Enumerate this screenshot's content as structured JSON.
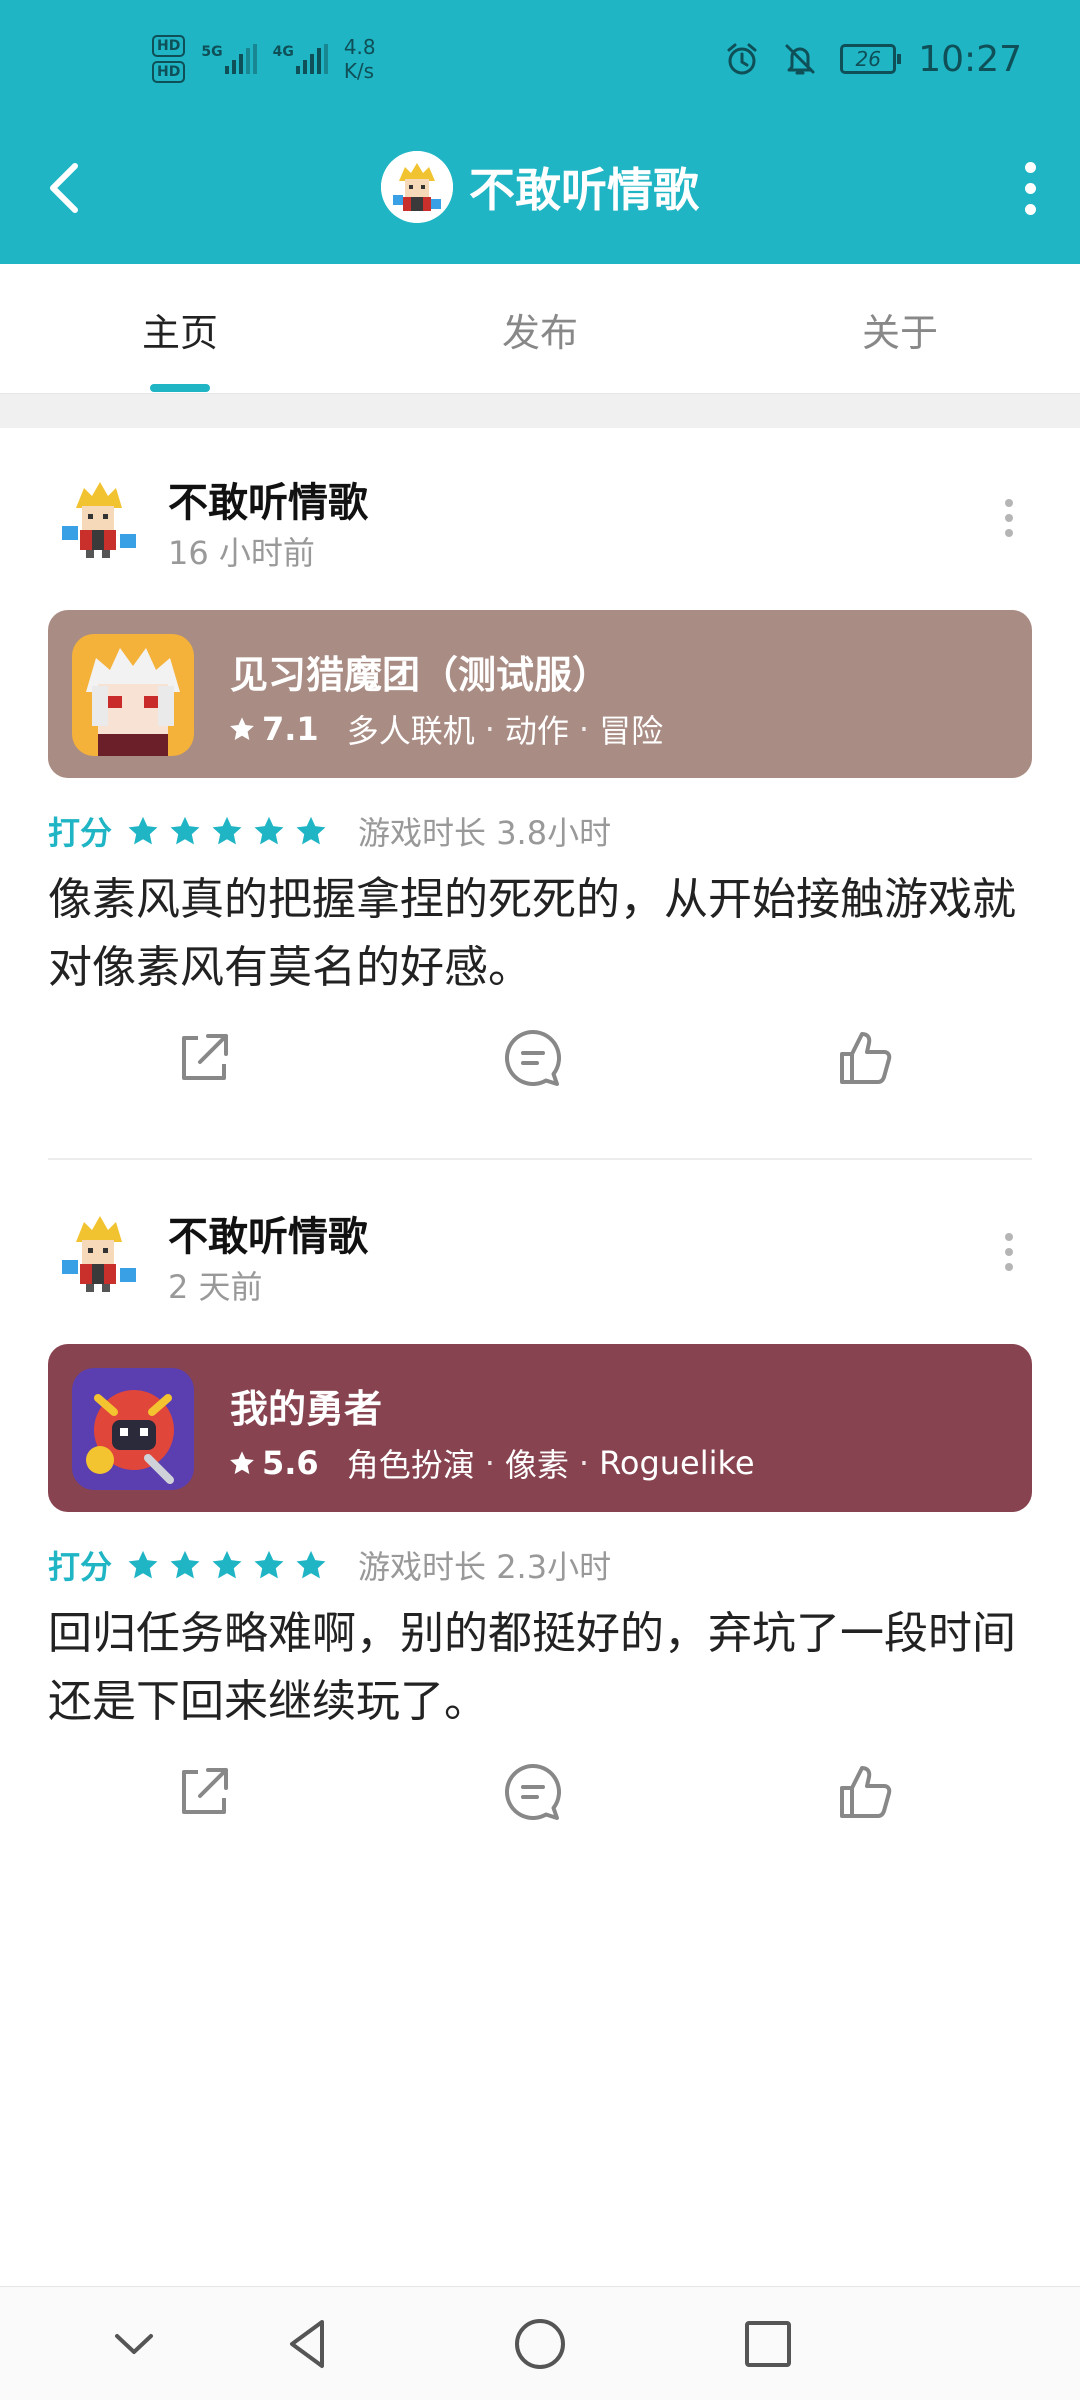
{
  "status_bar": {
    "hd1": "HD",
    "hd2": "HD",
    "net1": "5G",
    "net2": "4G",
    "speed_value": "4.8",
    "speed_unit": "K/s",
    "battery": "26",
    "time": "10:27"
  },
  "header": {
    "title": "不敢听情歌"
  },
  "tabs": [
    {
      "label": "主页",
      "active": true
    },
    {
      "label": "发布",
      "active": false
    },
    {
      "label": "关于",
      "active": false
    }
  ],
  "posts": [
    {
      "username": "不敢听情歌",
      "time": "16 小时前",
      "game": {
        "name": "见习猎魔团（测试服）",
        "rating": "7.1",
        "tags": [
          "多人联机",
          "动作",
          "冒险"
        ],
        "card_color": "#a98c83"
      },
      "rating_label": "打分",
      "stars": 5,
      "playtime": "游戏时长 3.8小时",
      "review": "像素风真的把握拿捏的死死的，从开始接触游戏就对像素风有莫名的好感。"
    },
    {
      "username": "不敢听情歌",
      "time": "2 天前",
      "game": {
        "name": "我的勇者",
        "rating": "5.6",
        "tags": [
          "角色扮演",
          "像素",
          "Roguelike"
        ],
        "card_color": "#87434f"
      },
      "rating_label": "打分",
      "stars": 5,
      "playtime": "游戏时长 2.3小时",
      "review": "回归任务略难啊，别的都挺好的，弃坑了一段时间还是下回来继续玩了。"
    }
  ],
  "colors": {
    "accent": "#1fb5c4",
    "header_bg": "#1fb5c4"
  },
  "icons": [
    "back-arrow-icon",
    "more-vertical-icon",
    "share-icon",
    "comment-icon",
    "like-icon",
    "star-icon",
    "nav-collapse-icon",
    "nav-back-icon",
    "nav-home-icon",
    "nav-recents-icon"
  ]
}
